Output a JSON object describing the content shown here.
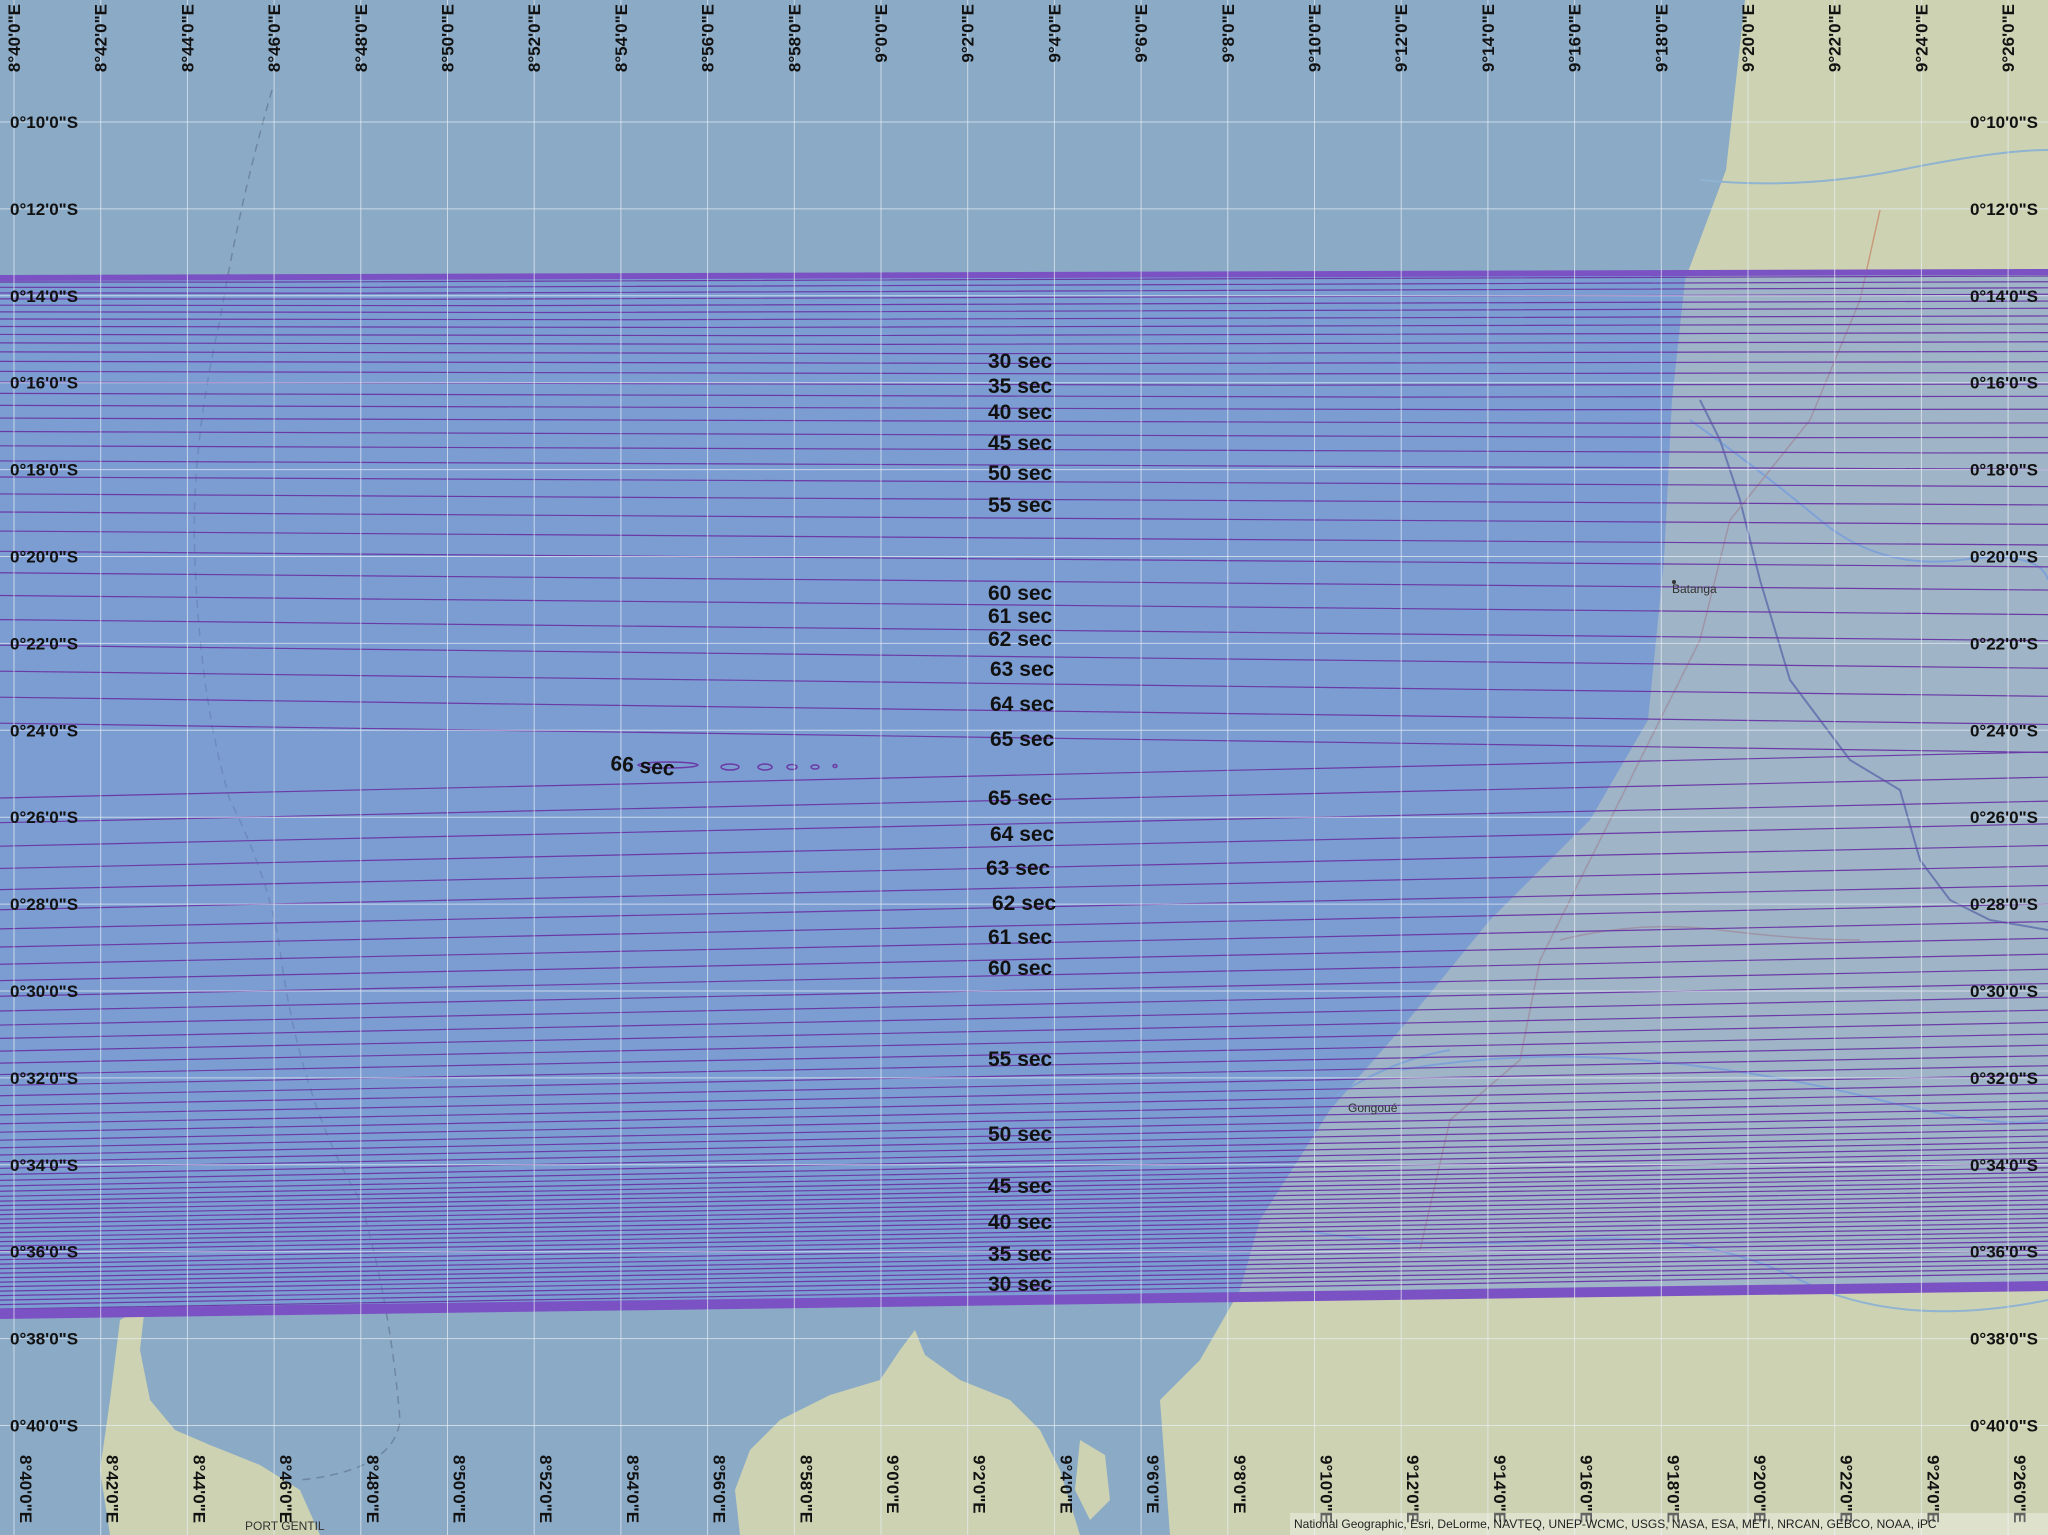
{
  "map": {
    "lon_labels": [
      "8°40'0\"E",
      "8°42'0\"E",
      "8°44'0\"E",
      "8°46'0\"E",
      "8°48'0\"E",
      "8°50'0\"E",
      "8°52'0\"E",
      "8°54'0\"E",
      "8°56'0\"E",
      "8°58'0\"E",
      "9°0'0\"E",
      "9°2'0\"E",
      "9°4'0\"E",
      "9°6'0\"E",
      "9°8'0\"E",
      "9°10'0\"E",
      "9°12'0\"E",
      "9°14'0\"E",
      "9°16'0\"E",
      "9°18'0\"E",
      "9°20'0\"E",
      "9°22'0\"E",
      "9°24'0\"E",
      "9°26'0\"E"
    ],
    "lat_labels": [
      "0°10'0\"S",
      "0°12'0\"S",
      "0°14'0\"S",
      "0°16'0\"S",
      "0°18'0\"S",
      "0°20'0\"S",
      "0°22'0\"S",
      "0°24'0\"S",
      "0°26'0\"S",
      "0°28'0\"S",
      "0°30'0\"S",
      "0°32'0\"S",
      "0°34'0\"S",
      "0°36'0\"S",
      "0°38'0\"S",
      "0°40'0\"S"
    ],
    "duration_labels_north": [
      "30 sec",
      "35 sec",
      "40 sec",
      "45 sec",
      "50 sec",
      "55 sec",
      "60 sec",
      "61 sec",
      "62 sec",
      "63 sec",
      "64 sec",
      "65 sec"
    ],
    "max_label": "66 sec",
    "duration_labels_south": [
      "65 sec",
      "64 sec",
      "63 sec",
      "62 sec",
      "61 sec",
      "60 sec",
      "55 sec",
      "50 sec",
      "45 sec",
      "40 sec",
      "35 sec",
      "30 sec"
    ],
    "places": [
      "Batanga",
      "Gongoué",
      "PORT GENTIL"
    ],
    "attribution": "National Geographic, Esri, DeLorme, NAVTEQ, UNEP-WCMC, USGS, NASA, ESA, METI, NRCAN, GEBCO, NOAA, iPC",
    "colors": {
      "ocean": "#8aaac6",
      "land": "#cdd3b2",
      "band": "#6a8fe0",
      "isoline": "#6a3aa6",
      "limit": "#7b52c4",
      "grid": "#e8eef5"
    }
  }
}
